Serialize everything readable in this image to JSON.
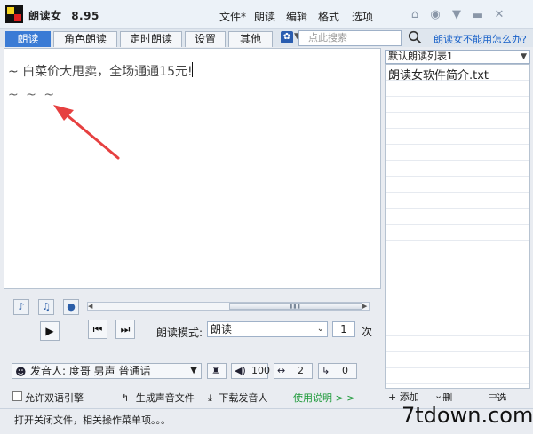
{
  "app": {
    "name": "朗读女",
    "version": "8.95"
  },
  "menu": [
    "文件*",
    "朗读",
    "编辑",
    "格式",
    "选项"
  ],
  "titlebar_icons": [
    "home-icon",
    "circle-dot-icon",
    "shirt-icon",
    "minimize-icon",
    "close-icon"
  ],
  "tabs": [
    "朗读",
    "角色朗读",
    "定时朗读",
    "设置",
    "其他"
  ],
  "active_tab": "朗读",
  "search": {
    "placeholder": "点此搜索"
  },
  "help_link": "朗读女不能用怎么办?",
  "editor": {
    "line1": "~ 白菜价大甩卖，全场通通15元!",
    "line2": "~ ~ ~"
  },
  "playlist": {
    "selected": "默认朗读列表1",
    "items": [
      "朗读女软件简介.txt"
    ],
    "actions": [
      "+ 添加",
      "删除",
      "选项"
    ]
  },
  "controls": {
    "mode_label": "朗读模式:",
    "mode_value": "朗读",
    "count_value": "1",
    "count_unit": "次",
    "progress_position": 0.5
  },
  "speaker": {
    "label": "发音人: 度哥 男声 普通话",
    "volume": "100",
    "speed": "2",
    "pitch": "0"
  },
  "options": {
    "dual_label": "允许双语引擎",
    "dual_checked": false,
    "generate_label": "生成声音文件",
    "download_label": "下载发音人",
    "usage_label": "使用说明 > >"
  },
  "status": {
    "text": "打开关闭文件，相关操作菜单项。。。"
  },
  "watermark": "7tdown.com",
  "colors": {
    "accent": "#3a7bd5",
    "link": "#1a62c9",
    "usage": "#1e9a3a",
    "arrow": "#e64040"
  }
}
